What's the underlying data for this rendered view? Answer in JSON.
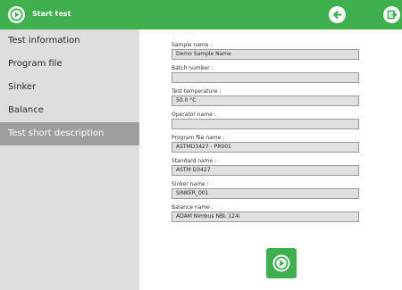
{
  "header": {
    "title": "Start test",
    "colors": {
      "bar": "#3fb04d",
      "icon_bg": "#ffffff"
    },
    "icons": [
      "play-icon",
      "back-arrow-icon",
      "exit-icon"
    ]
  },
  "sidebar": {
    "items": [
      {
        "label": "Test information"
      },
      {
        "label": "Program file"
      },
      {
        "label": "Sinker"
      },
      {
        "label": "Balance"
      },
      {
        "label": "Test short description",
        "active": true
      }
    ]
  },
  "form": {
    "fields": [
      {
        "label": "Sample name :",
        "value": "Demo Sample Name"
      },
      {
        "label": "Batch number :",
        "value": ""
      },
      {
        "label": "Test temperature :",
        "value": "50.0 °C"
      },
      {
        "label": "Operator name :",
        "value": ""
      },
      {
        "label": "Program file name :",
        "value": "ASTMD3427 - PR001"
      },
      {
        "label": "Standard name :",
        "value": "ASTM D3427"
      },
      {
        "label": "Sinker name :",
        "value": "SINKER_001"
      },
      {
        "label": "Balance name :",
        "value": "ADAM Nimbus NBL 124i"
      }
    ]
  },
  "actions": {
    "start_icon": "play-icon"
  }
}
